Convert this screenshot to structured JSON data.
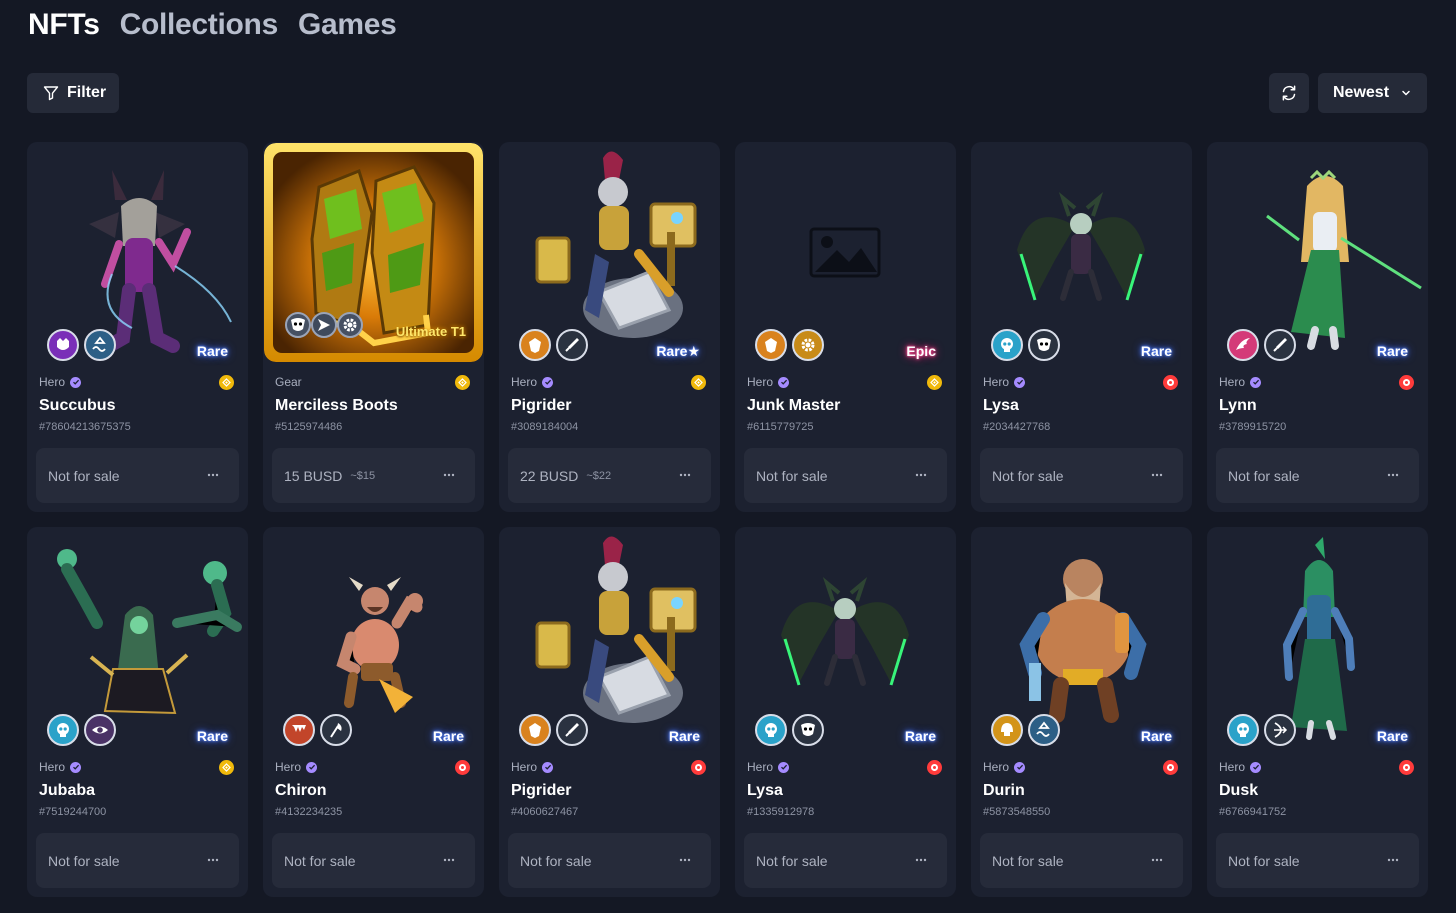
{
  "tabs": [
    {
      "label": "NFTs",
      "active": true
    },
    {
      "label": "Collections",
      "active": false
    },
    {
      "label": "Games",
      "active": false
    }
  ],
  "toolbar": {
    "filter_label": "Filter",
    "refresh_icon": "refresh-icon",
    "sort_label": "Newest"
  },
  "colors": {
    "background": "#141824",
    "card": "#1c2130",
    "rare_glow": "#3d65ff",
    "epic_glow": "#ff2470",
    "bnb": "#f0b90b",
    "alt_chain": "#ff3b3b",
    "verified": "#a58bff"
  },
  "cards": [
    {
      "type": "Hero",
      "name": "Succubus",
      "id": "#78604213675375",
      "rarity": "Rare",
      "price": "Not for sale",
      "usd": "",
      "chain": "bnb",
      "art": "succubus-hero",
      "skills": [
        [
          "#7a2fb8",
          "demon-mask-icon"
        ],
        [
          "#2c5f86",
          "wave-icon"
        ]
      ]
    },
    {
      "type": "Gear",
      "name": "Merciless Boots",
      "id": "#5125974486",
      "rarity": "Ultimate T1",
      "price": "15 BUSD",
      "usd": "~$15",
      "chain": "bnb",
      "art": "boots-gear",
      "skills": [
        [
          "#465062",
          "mask-icon"
        ],
        [
          "#3f4a5c",
          "arrow-icon"
        ],
        [
          "#465062",
          "gear-icon"
        ]
      ]
    },
    {
      "type": "Hero",
      "name": "Pigrider",
      "id": "#3089184004",
      "rarity": "Rare★",
      "price": "22 BUSD",
      "usd": "~$22",
      "chain": "bnb",
      "art": "pigrider-hero",
      "skills": [
        [
          "#d9821e",
          "crest-icon"
        ],
        [
          "#2a3240",
          "sword-icon"
        ]
      ]
    },
    {
      "type": "Hero",
      "name": "Junk Master",
      "id": "#6115779725",
      "rarity": "Epic",
      "price": "Not for sale",
      "usd": "",
      "chain": "bnb",
      "art": "image-placeholder",
      "skills": [
        [
          "#d9821e",
          "crest-icon"
        ],
        [
          "#c88b18",
          "gear-icon"
        ]
      ]
    },
    {
      "type": "Hero",
      "name": "Lysa",
      "id": "#2034427768",
      "rarity": "Rare",
      "price": "Not for sale",
      "usd": "",
      "chain": "red",
      "art": "lysa-hero",
      "skills": [
        [
          "#2aa2c9",
          "skull-icon"
        ],
        [
          "#2a3240",
          "mask-icon"
        ]
      ]
    },
    {
      "type": "Hero",
      "name": "Lynn",
      "id": "#3789915720",
      "rarity": "Rare",
      "price": "Not for sale",
      "usd": "",
      "chain": "red",
      "art": "lynn-hero",
      "skills": [
        [
          "#d43a78",
          "wing-icon"
        ],
        [
          "#2a3240",
          "sword-icon"
        ]
      ]
    },
    {
      "type": "Hero",
      "name": "Jubaba",
      "id": "#7519244700",
      "rarity": "Rare",
      "price": "Not for sale",
      "usd": "",
      "chain": "bnb",
      "art": "jubaba-hero",
      "skills": [
        [
          "#2aa2c9",
          "skull-icon"
        ],
        [
          "#4a3266",
          "eye-icon"
        ]
      ]
    },
    {
      "type": "Hero",
      "name": "Chiron",
      "id": "#4132234235",
      "rarity": "Rare",
      "price": "Not for sale",
      "usd": "",
      "chain": "red",
      "art": "chiron-hero",
      "skills": [
        [
          "#c2452a",
          "fang-icon"
        ],
        [
          "#2a3240",
          "axe-icon"
        ]
      ]
    },
    {
      "type": "Hero",
      "name": "Pigrider",
      "id": "#4060627467",
      "rarity": "Rare",
      "price": "Not for sale",
      "usd": "",
      "chain": "red",
      "art": "pigrider-hero",
      "skills": [
        [
          "#d9821e",
          "crest-icon"
        ],
        [
          "#2a3240",
          "sword-icon"
        ]
      ]
    },
    {
      "type": "Hero",
      "name": "Lysa",
      "id": "#1335912978",
      "rarity": "Rare",
      "price": "Not for sale",
      "usd": "",
      "chain": "red",
      "art": "lysa-hero",
      "skills": [
        [
          "#2aa2c9",
          "skull-icon"
        ],
        [
          "#2a3240",
          "mask-icon"
        ]
      ]
    },
    {
      "type": "Hero",
      "name": "Durin",
      "id": "#5873548550",
      "rarity": "Rare",
      "price": "Not for sale",
      "usd": "",
      "chain": "red",
      "art": "durin-hero",
      "skills": [
        [
          "#d39419",
          "helmet-icon"
        ],
        [
          "#2c5f86",
          "wave-icon"
        ]
      ]
    },
    {
      "type": "Hero",
      "name": "Dusk",
      "id": "#6766941752",
      "rarity": "Rare",
      "price": "Not for sale",
      "usd": "",
      "chain": "red",
      "art": "dusk-hero",
      "skills": [
        [
          "#2aa2c9",
          "skull-icon"
        ],
        [
          "#2a3240",
          "bow-icon"
        ]
      ]
    }
  ]
}
